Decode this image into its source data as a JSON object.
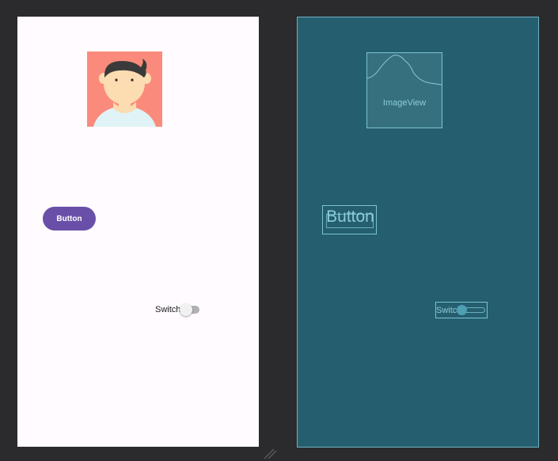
{
  "design_view": {
    "image_view": {
      "icon": "avatar-person"
    },
    "button": {
      "label": "Button"
    },
    "switch": {
      "label": "Switch",
      "checked": false
    }
  },
  "blueprint_view": {
    "image_view": {
      "label": "ImageView"
    },
    "button": {
      "label": "Button"
    },
    "switch": {
      "label": "Switch"
    }
  },
  "colors": {
    "editor_background": "#2b2b2d",
    "design_surface": "#fffbfe",
    "blueprint_surface": "#245e6f",
    "blueprint_outline": "#7cc3d2",
    "blueprint_text": "#8ccbd8",
    "avatar_background": "#fa8b7c",
    "button_primary": "#6a4fa8"
  }
}
